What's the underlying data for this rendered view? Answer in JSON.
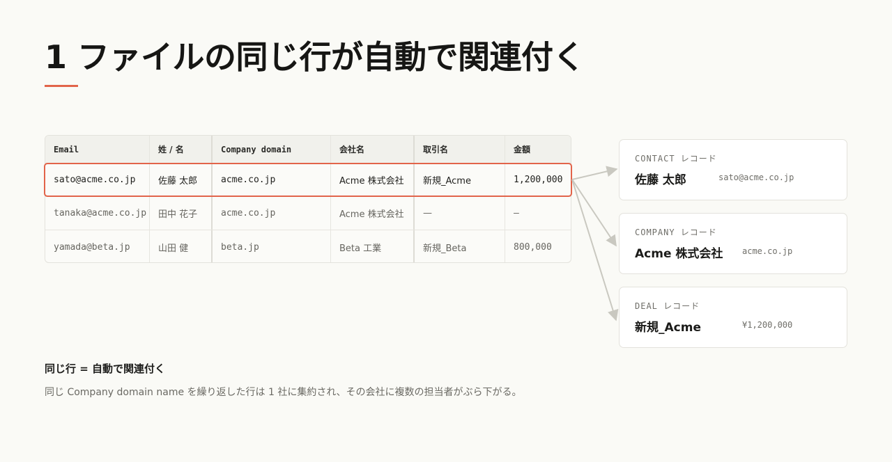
{
  "page": {
    "title": "1 ファイルの同じ行が自動で関連付く"
  },
  "sheet": {
    "columns": [
      "Email",
      "姓 / 名",
      "Company domain",
      "会社名",
      "取引名",
      "金額"
    ],
    "rows": [
      [
        "sato@acme.co.jp",
        "佐藤 太郎",
        "acme.co.jp",
        "Acme 株式会社",
        "新規_Acme",
        "1,200,000"
      ],
      [
        "tanaka@acme.co.jp",
        "田中 花子",
        "acme.co.jp",
        "Acme 株式会社",
        "—",
        "—"
      ],
      [
        "yamada@beta.jp",
        "山田 健",
        "beta.jp",
        "Beta 工業",
        "新規_Beta",
        "800,000"
      ]
    ],
    "highlighted_row": 0
  },
  "records": [
    {
      "type": "CONTACT レコード",
      "name": "佐藤 太郎",
      "meta": "sato@acme.co.jp"
    },
    {
      "type": "COMPANY レコード",
      "name": "Acme 株式会社",
      "meta": "acme.co.jp"
    },
    {
      "type": "DEAL レコード",
      "name": "新規_Acme",
      "meta": "¥1,200,000"
    }
  ],
  "note": {
    "title": "同じ行 = 自動で関連付く",
    "body": "同じ Company domain name を繰り返した行は 1 社に集約され、その会社に複数の担当者がぶら下がる。"
  },
  "colors": {
    "accent": "#e2644a",
    "connector": "#c9c8c0"
  }
}
